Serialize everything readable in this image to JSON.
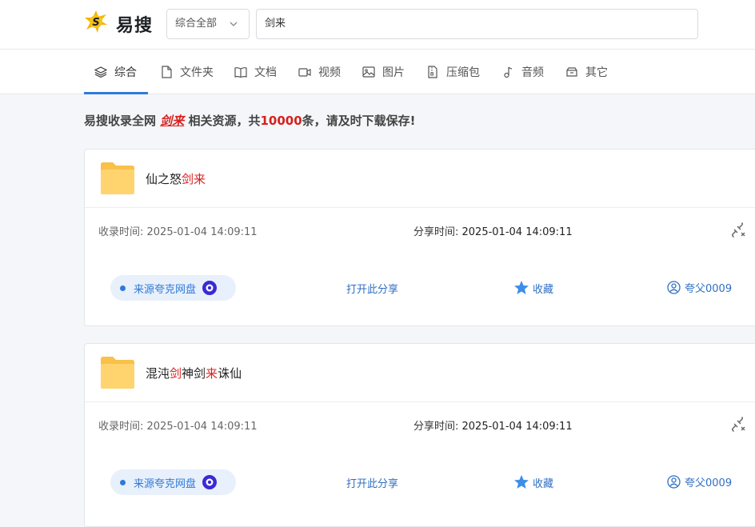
{
  "header": {
    "logo_icon": "lightning-s-logo",
    "logo_text": "易搜",
    "select_value": "综合全部",
    "search_value": "剑来"
  },
  "tabs": [
    {
      "label": "综合",
      "icon": "layers-icon",
      "active": true
    },
    {
      "label": "文件夹",
      "icon": "file-icon"
    },
    {
      "label": "文档",
      "icon": "book-icon"
    },
    {
      "label": "视频",
      "icon": "video-icon"
    },
    {
      "label": "图片",
      "icon": "image-icon"
    },
    {
      "label": "压缩包",
      "icon": "zip-icon"
    },
    {
      "label": "音频",
      "icon": "music-icon"
    },
    {
      "label": "其它",
      "icon": "box-icon"
    }
  ],
  "notice": {
    "prefix": "易搜收录全网 ",
    "keyword": "剑来",
    "middle": " 相关资源，共",
    "count": "10000",
    "suffix": "条，请及时下载保存!"
  },
  "results": [
    {
      "title_parts": [
        "仙之怒",
        "剑来"
      ],
      "collected": "收录时间: 2025-01-04 14:09:11",
      "shared_label": "分享时间: ",
      "shared_time": "2025-01-04 14:09:11",
      "source": "来源夸克网盘",
      "open_share": "打开此分享",
      "favorite": "收藏",
      "user": "夸父0009"
    },
    {
      "title_parts": [
        "混沌",
        "剑",
        "神剑",
        "来",
        "诛仙"
      ],
      "collected": "收录时间: 2025-01-04 14:09:11",
      "shared_label": "分享时间: ",
      "shared_time": "2025-01-04 14:09:11",
      "source": "来源夸克网盘",
      "open_share": "打开此分享",
      "favorite": "收藏",
      "user": "夸父0009"
    }
  ],
  "colors": {
    "accent": "#2f7ad8",
    "highlight": "#d8201d",
    "folder": "#ffcf66"
  }
}
